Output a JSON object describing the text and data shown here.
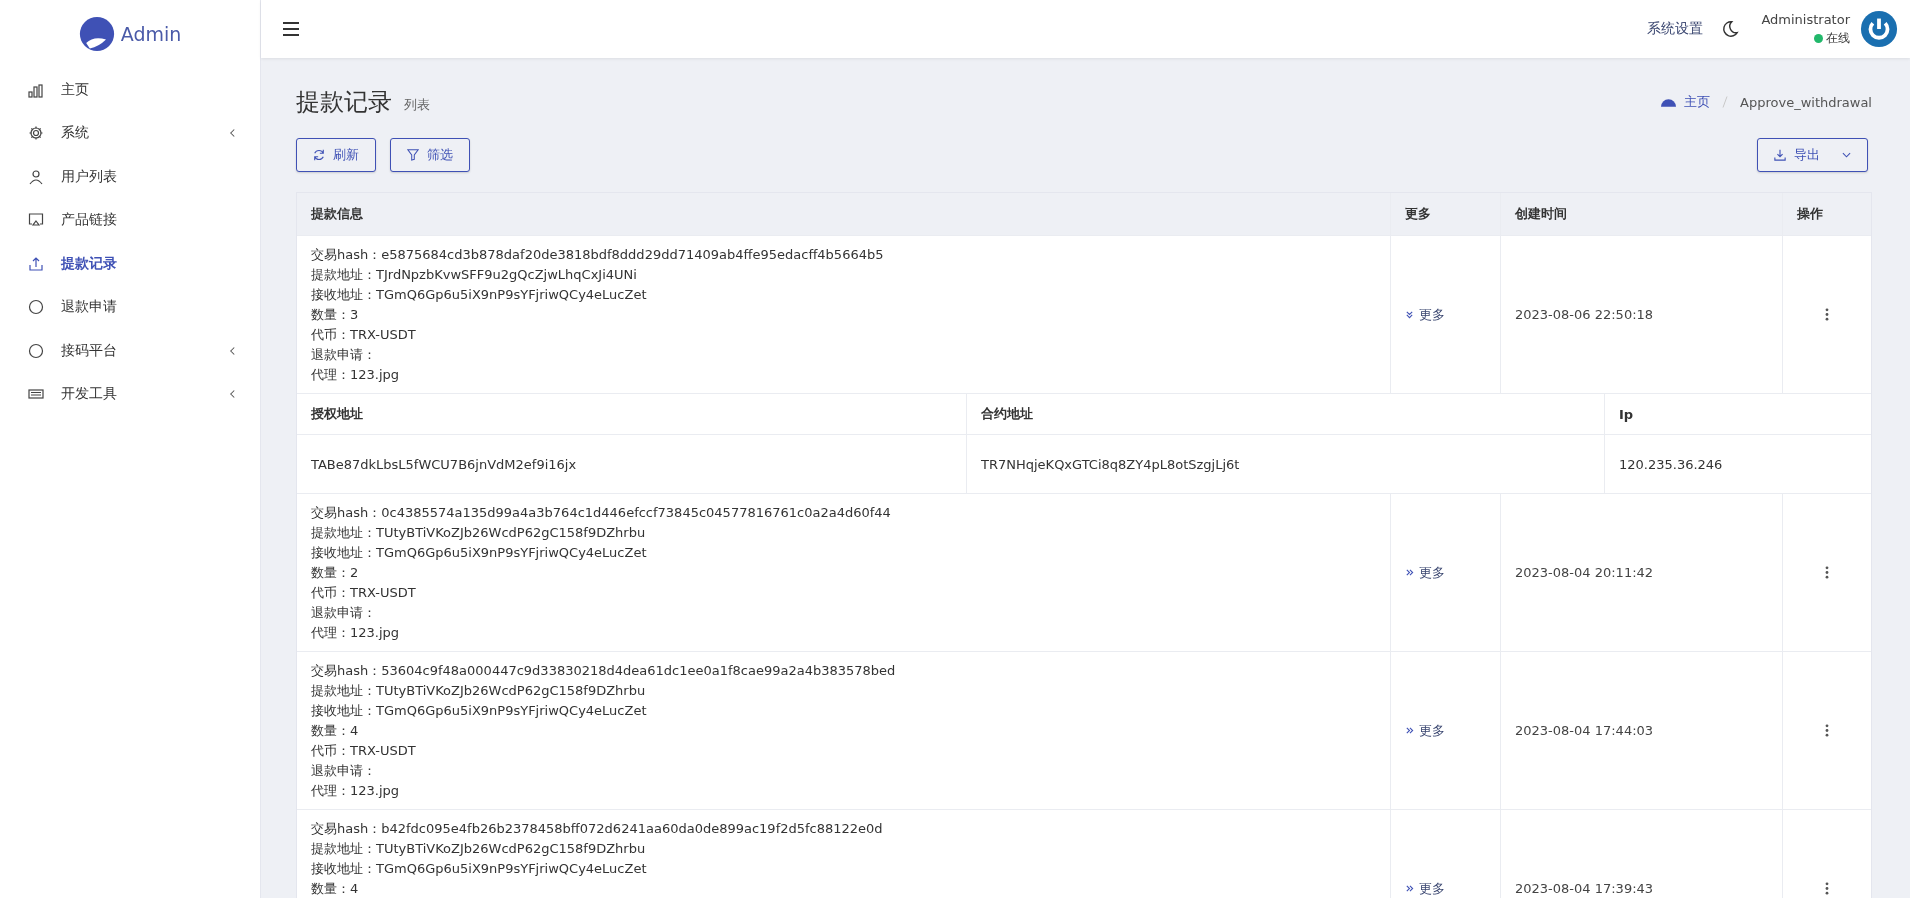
{
  "brand": {
    "name": "Admin"
  },
  "sidebar": {
    "items": [
      {
        "label": "主页",
        "selected": false,
        "has_submenu": false
      },
      {
        "label": "系统",
        "selected": false,
        "has_submenu": true
      },
      {
        "label": "用户列表",
        "selected": false,
        "has_submenu": false
      },
      {
        "label": "产品链接",
        "selected": false,
        "has_submenu": false
      },
      {
        "label": "提款记录",
        "selected": true,
        "has_submenu": false
      },
      {
        "label": "退款申请",
        "selected": false,
        "has_submenu": false
      },
      {
        "label": "接码平台",
        "selected": false,
        "has_submenu": true
      },
      {
        "label": "开发工具",
        "selected": false,
        "has_submenu": true
      }
    ]
  },
  "header": {
    "settings": "系统设置",
    "user": "Administrator",
    "status": "在线"
  },
  "page": {
    "title": "提款记录",
    "subtitle": "列表",
    "breadcrumb": [
      "主页",
      "Approve_withdrawal"
    ]
  },
  "toolbar": {
    "refresh": "刷新",
    "filter": "筛选",
    "export": "导出"
  },
  "table": {
    "columns": [
      "提款信息",
      "更多",
      "创建时间",
      "操作"
    ],
    "detail_columns": [
      "授权地址",
      "合约地址",
      "Ip"
    ],
    "rows": [
      {
        "lines": [
          "交易hash：e5875684cd3b878daf20de3818bdf8ddd29dd71409ab4ffe95edacff4b5664b5",
          "提款地址：TJrdNpzbKvwSFF9u2gQcZjwLhqCxJi4UNi",
          "接收地址：TGmQ6Gp6u5iX9nP9sYFjriwQCy4eLucZet",
          "数量：3",
          "代币：TRX-USDT",
          "退款申请：",
          "代理：123.jpg"
        ],
        "more": "更多",
        "expanded": true,
        "created": "2023-08-06 22:50:18",
        "detail": [
          "TABe87dkLbsL5fWCU7B6jnVdM2ef9i16jx",
          "TR7NHqjeKQxGTCi8q8ZY4pL8otSzgjLj6t",
          "120.235.36.246"
        ]
      },
      {
        "lines": [
          "交易hash：0c4385574a135d99a4a3b764c1d446efccf73845c04577816761c0a2a4d60f44",
          "提款地址：TUtyBTiVKoZJb26WcdP62gC158f9DZhrbu",
          "接收地址：TGmQ6Gp6u5iX9nP9sYFjriwQCy4eLucZet",
          "数量：2",
          "代币：TRX-USDT",
          "退款申请：",
          "代理：123.jpg"
        ],
        "more": "更多",
        "expanded": false,
        "created": "2023-08-04 20:11:42"
      },
      {
        "lines": [
          "交易hash：53604c9f48a000447c9d33830218d4dea61dc1ee0a1f8cae99a2a4b383578bed",
          "提款地址：TUtyBTiVKoZJb26WcdP62gC158f9DZhrbu",
          "接收地址：TGmQ6Gp6u5iX9nP9sYFjriwQCy4eLucZet",
          "数量：4",
          "代币：TRX-USDT",
          "退款申请：",
          "代理：123.jpg"
        ],
        "more": "更多",
        "expanded": false,
        "created": "2023-08-04 17:44:03"
      },
      {
        "lines": [
          "交易hash：b42fdc095e4fb26b2378458bff072d6241aa60da0de899ac19f2d5fc88122e0d",
          "提款地址：TUtyBTiVKoZJb26WcdP62gC158f9DZhrbu",
          "接收地址：TGmQ6Gp6u5iX9nP9sYFjriwQCy4eLucZet",
          "数量：4"
        ],
        "more": "更多",
        "expanded": false,
        "created": "2023-08-04 17:39:43"
      }
    ]
  }
}
